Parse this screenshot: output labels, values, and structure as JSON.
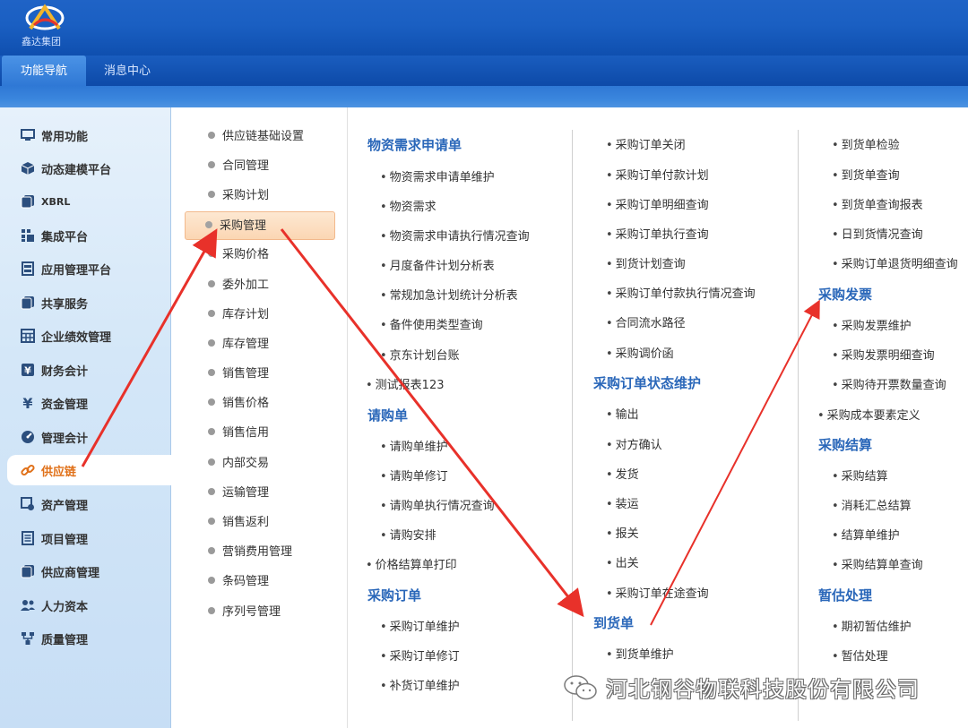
{
  "header": {
    "logo_text": "鑫达集团",
    "nav_tabs": [
      {
        "label": "功能导航",
        "active": true
      },
      {
        "label": "消息中心",
        "active": false
      }
    ]
  },
  "sidebar": {
    "items": [
      {
        "label": "常用功能",
        "icon": "monitor-icon"
      },
      {
        "label": "动态建模平台",
        "icon": "cube-icon"
      },
      {
        "label": "XBRL",
        "icon": "pages-icon"
      },
      {
        "label": "集成平台",
        "icon": "grid-icon"
      },
      {
        "label": "应用管理平台",
        "icon": "panel-icon"
      },
      {
        "label": "共享服务",
        "icon": "pages-icon"
      },
      {
        "label": "企业绩效管理",
        "icon": "table-icon"
      },
      {
        "label": "财务会计",
        "icon": "yen-icon"
      },
      {
        "label": "资金管理",
        "icon": "yen-icon"
      },
      {
        "label": "管理会计",
        "icon": "gauge-icon"
      },
      {
        "label": "供应链",
        "icon": "link-icon",
        "active": true
      },
      {
        "label": "资产管理",
        "icon": "asset-icon"
      },
      {
        "label": "项目管理",
        "icon": "list-icon"
      },
      {
        "label": "供应商管理",
        "icon": "pages-icon"
      },
      {
        "label": "人力资本",
        "icon": "people-icon"
      },
      {
        "label": "质量管理",
        "icon": "org-icon"
      }
    ]
  },
  "submenu": {
    "items": [
      "供应链基础设置",
      "合同管理",
      "采购计划",
      "采购管理",
      "采购价格",
      "委外加工",
      "库存计划",
      "库存管理",
      "销售管理",
      "销售价格",
      "销售信用",
      "内部交易",
      "运输管理",
      "销售返利",
      "营销费用管理",
      "条码管理",
      "序列号管理"
    ],
    "selected_index": 3
  },
  "content": {
    "col1": {
      "sec_wuzi": "物资需求申请单",
      "wuzi_links": [
        "物资需求申请单维护",
        "物资需求",
        "物资需求申请执行情况查询",
        "月度备件计划分析表",
        "常规加急计划统计分析表",
        "备件使用类型查询",
        "京东计划台账"
      ],
      "test_link": "测试报表123",
      "sec_qinggou": "请购单",
      "qinggou_links": [
        "请购单维护",
        "请购单修订",
        "请购单执行情况查询",
        "请购安排"
      ],
      "price_link": "价格结算单打印",
      "sec_order": "采购订单",
      "order_links": [
        "采购订单维护",
        "采购订单修订",
        "补货订单维护"
      ]
    },
    "col2": {
      "top_links": [
        "采购订单关闭",
        "采购订单付款计划",
        "采购订单明细查询",
        "采购订单执行查询",
        "到货计划查询",
        "采购订单付款执行情况查询",
        "合同流水路径",
        "采购调价函"
      ],
      "sec_status": "采购订单状态维护",
      "status_links": [
        "输出",
        "对方确认",
        "发货",
        "装运",
        "报关",
        "出关",
        "采购订单在途查询"
      ],
      "sec_arrival": "到货单",
      "arrival_links": [
        "到货单维护"
      ]
    },
    "col3": {
      "top_links": [
        "到货单检验",
        "到货单查询",
        "到货单查询报表",
        "日到货情况查询",
        "采购订单退货明细查询"
      ],
      "sec_invoice": "采购发票",
      "invoice_links": [
        "采购发票维护",
        "采购发票明细查询",
        "采购待开票数量查询"
      ],
      "cost_link": "采购成本要素定义",
      "sec_settle": "采购结算",
      "settle_links": [
        "采购结算",
        "消耗汇总结算",
        "结算单维护",
        "采购结算单查询"
      ],
      "sec_estimate": "暂估处理",
      "estimate_links": [
        "期初暂估维护",
        "暂估处理"
      ]
    }
  },
  "watermark": {
    "text": "河北钢谷物联科技股份有限公司"
  },
  "colors": {
    "header_blue": "#1a5fc2",
    "section_blue": "#2a67b9",
    "active_orange": "#e07018",
    "arrow_red": "#e8312a"
  }
}
